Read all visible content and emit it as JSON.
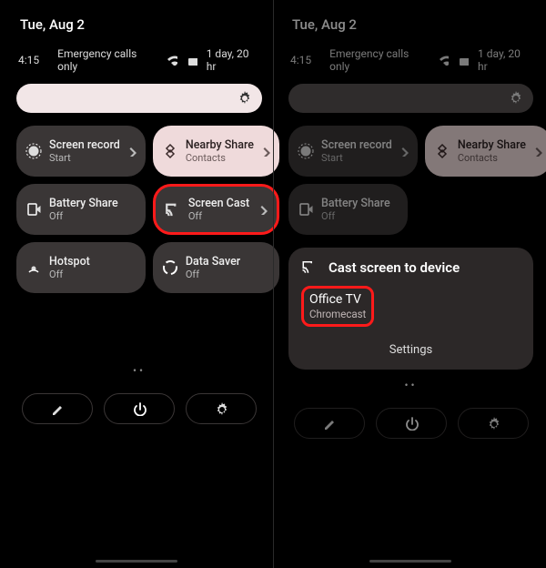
{
  "left": {
    "date": "Tue, Aug 2",
    "time": "4:15",
    "carrier": "Emergency calls only",
    "battery": "1 day, 20 hr",
    "tiles": {
      "screen_record": {
        "label": "Screen record",
        "sub": "Start"
      },
      "nearby_share": {
        "label": "Nearby Share",
        "sub": "Contacts"
      },
      "battery_share": {
        "label": "Battery Share",
        "sub": "Off"
      },
      "screen_cast": {
        "label": "Screen Cast",
        "sub": "Off"
      },
      "hotspot": {
        "label": "Hotspot",
        "sub": "Off"
      },
      "data_saver": {
        "label": "Data Saver",
        "sub": "Off"
      }
    }
  },
  "right": {
    "date": "Tue, Aug 2",
    "time": "4:15",
    "carrier": "Emergency calls only",
    "battery": "1 day, 20 hr",
    "tiles": {
      "screen_record": {
        "label": "Screen record",
        "sub": "Start"
      },
      "nearby_share": {
        "label": "Nearby Share",
        "sub": "Contacts"
      },
      "battery_share": {
        "label": "Battery Share",
        "sub": "Off"
      }
    },
    "cast": {
      "title": "Cast screen to device",
      "device_name": "Office TV",
      "device_type": "Chromecast",
      "settings": "Settings"
    }
  }
}
